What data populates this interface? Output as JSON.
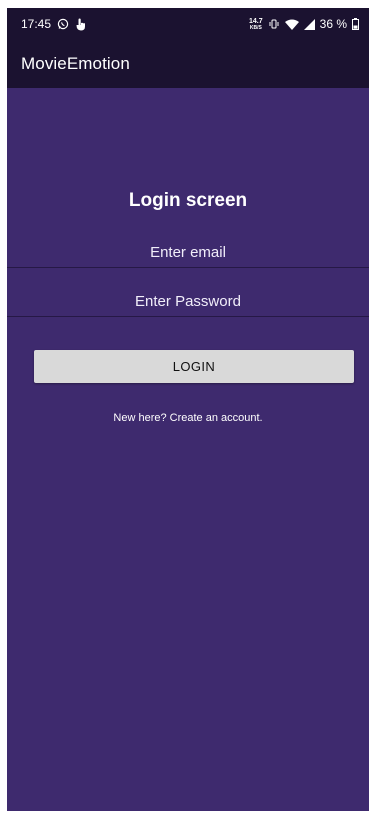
{
  "status_bar": {
    "time": "17:45",
    "net_speed_value": "14.7",
    "net_speed_unit": "KB/S",
    "battery_percent": "36 %",
    "icons": [
      "whatsapp-icon",
      "touch-icon",
      "vibrate-icon",
      "wifi-icon",
      "signal-icon",
      "battery-icon"
    ]
  },
  "app_bar": {
    "title": "MovieEmotion"
  },
  "login": {
    "title": "Login screen",
    "email_placeholder": "Enter email",
    "password_placeholder": "Enter Password",
    "login_button_label": "LOGIN",
    "signup_link": "New here? Create an account."
  },
  "colors": {
    "background": "#3e2a6e",
    "app_bar": "#1b1230",
    "button": "#d9d9d9"
  }
}
